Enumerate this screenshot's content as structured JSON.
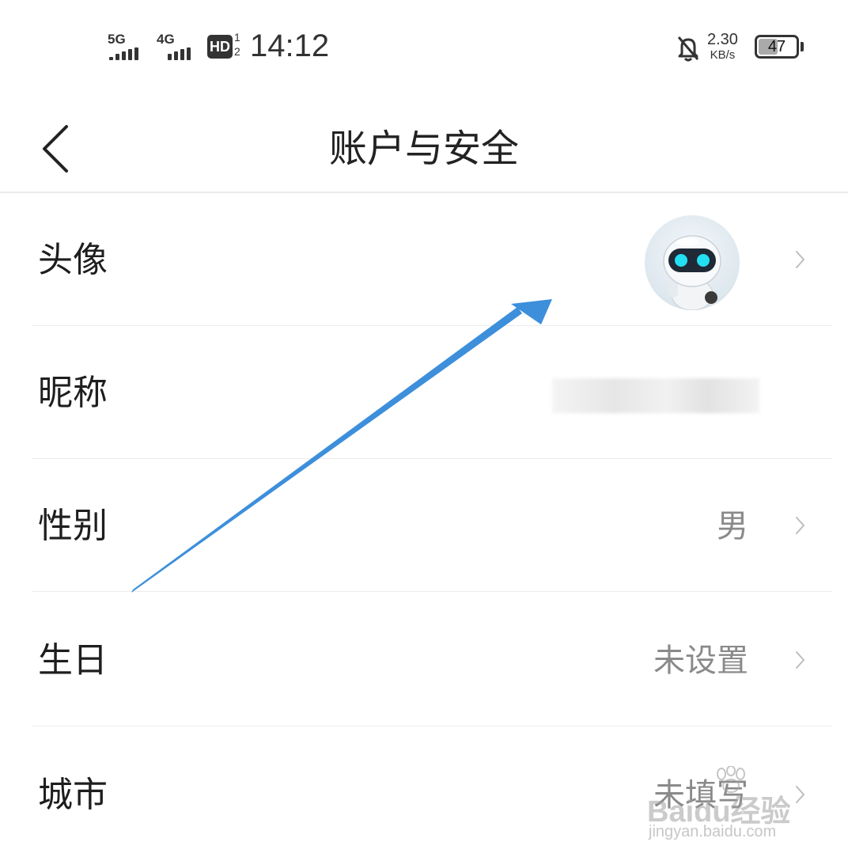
{
  "status_bar": {
    "network1": "5G",
    "network2": "4G",
    "hd": "HD",
    "hd_sub_top": "1",
    "hd_sub_bottom": "2",
    "time": "14:12",
    "speed_value": "2.30",
    "speed_unit": "KB/s",
    "battery_level": "47",
    "battery_fraction": 0.47,
    "icons": [
      "signal-5g-icon",
      "signal-4g-icon",
      "hd-voice-icon",
      "mute-bell-icon",
      "battery-icon"
    ]
  },
  "header": {
    "title": "账户与安全",
    "back_icon": "chevron-left-icon"
  },
  "rows": [
    {
      "label": "头像",
      "value": "",
      "kind": "avatar"
    },
    {
      "label": "昵称",
      "value": "",
      "kind": "blurred"
    },
    {
      "label": "性别",
      "value": "男"
    },
    {
      "label": "生日",
      "value": "未设置"
    },
    {
      "label": "城市",
      "value": "未填写"
    }
  ],
  "annotation": {
    "color": "#3d8fdb",
    "icon": "pointer-arrow"
  },
  "watermark": {
    "brand": "Baidu经验",
    "url": "jingyan.baidu.com"
  }
}
